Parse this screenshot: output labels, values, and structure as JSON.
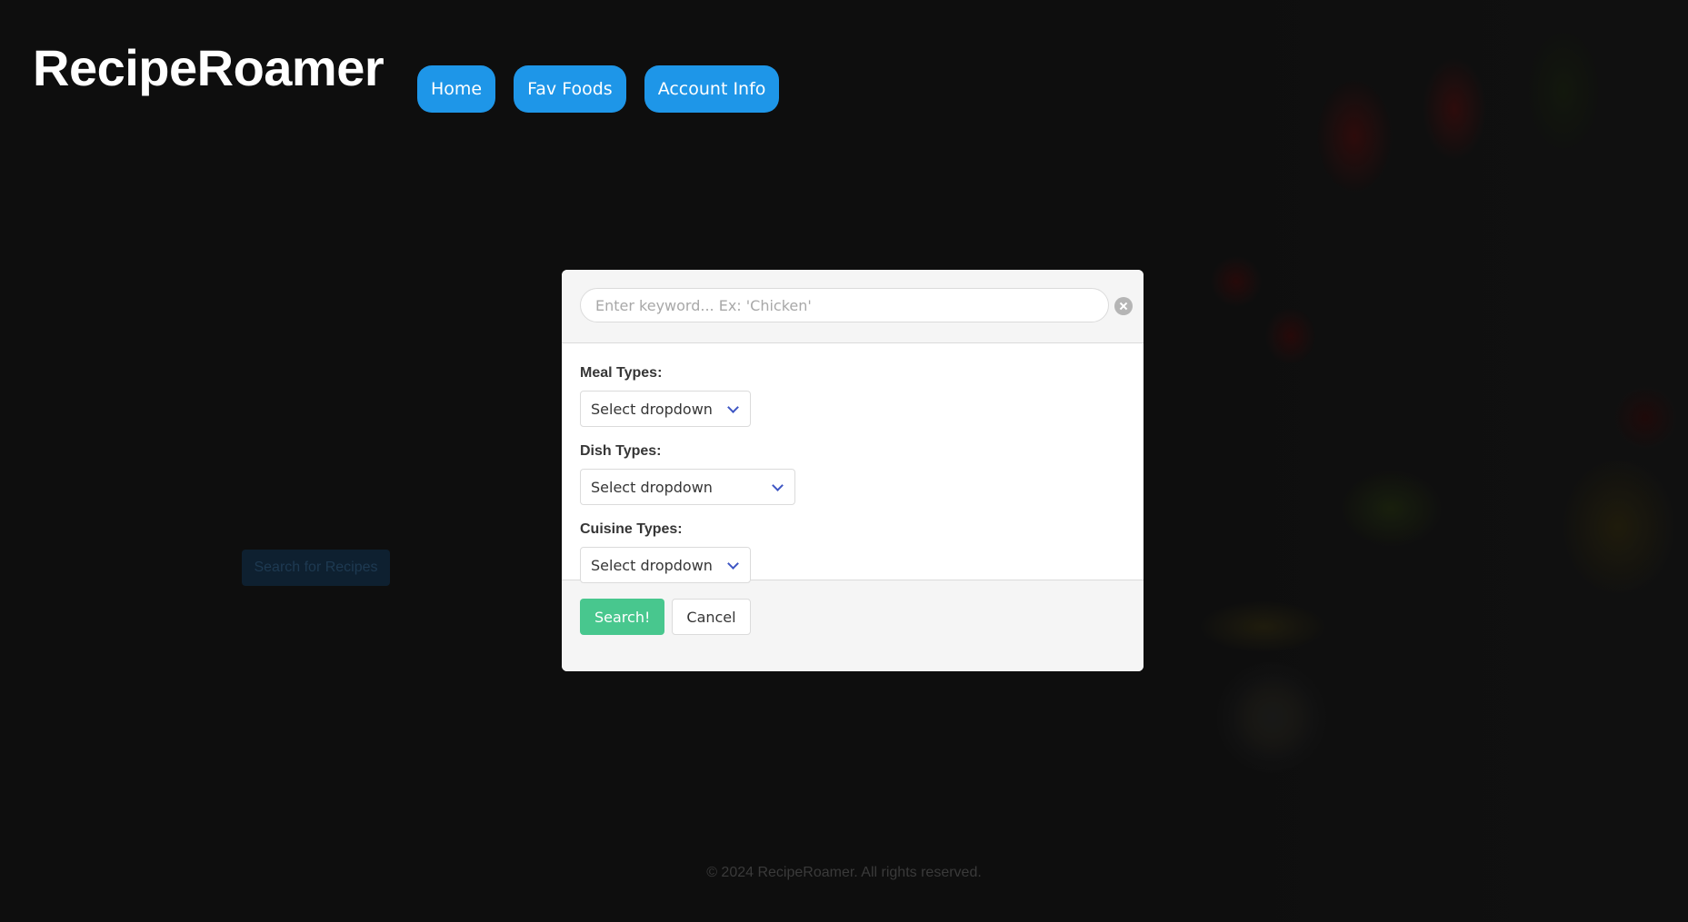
{
  "header": {
    "logo": "RecipeRoamer",
    "nav": [
      {
        "label": "Home"
      },
      {
        "label": "Fav Foods"
      },
      {
        "label": "Account Info"
      }
    ]
  },
  "background": {
    "search_button_label": "Search for Recipes"
  },
  "modal": {
    "search": {
      "value": "",
      "placeholder": "Enter keyword... Ex: 'Chicken'"
    },
    "filters": [
      {
        "label": "Meal Types:",
        "selected": "Select dropdown"
      },
      {
        "label": "Dish Types:",
        "selected": "Select dropdown"
      },
      {
        "label": "Cuisine Types:",
        "selected": "Select dropdown"
      }
    ],
    "search_button_label": "Search!",
    "cancel_button_label": "Cancel"
  },
  "footer": {
    "text": "© 2024 RecipeRoamer. All rights reserved."
  },
  "colors": {
    "nav_button": "#1e96e8",
    "search_button": "#48c78e",
    "chevron": "#3e56c4"
  },
  "icons": [
    "clear-icon",
    "chevron-down-icon"
  ]
}
